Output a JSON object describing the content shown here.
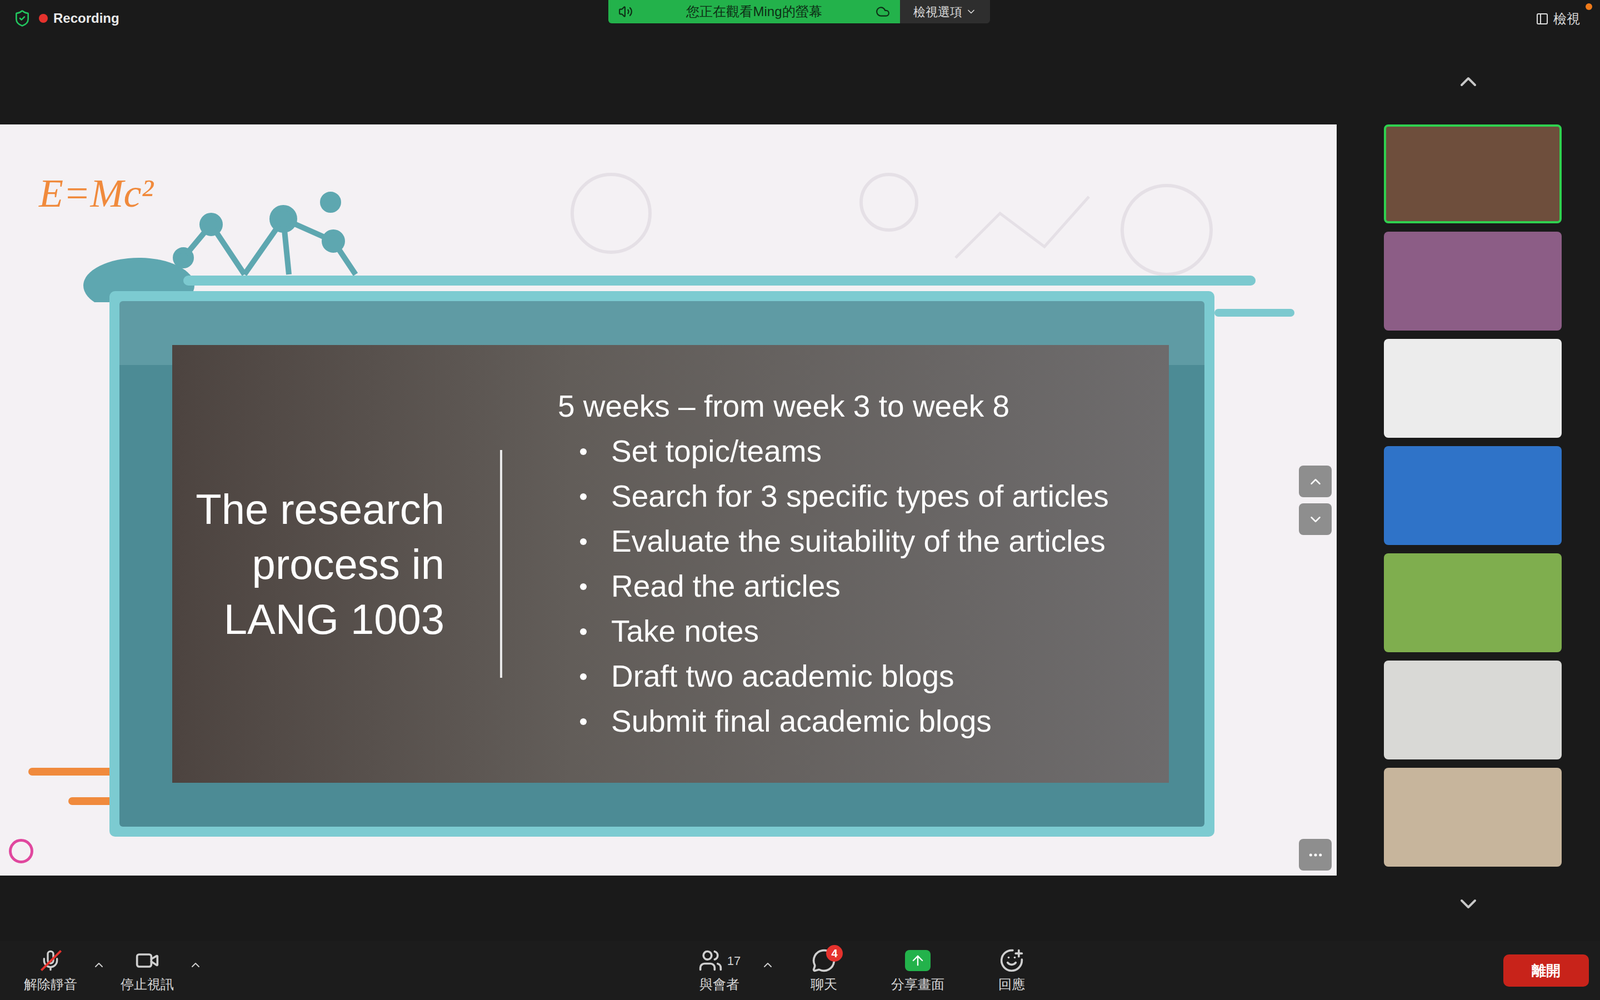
{
  "recording": {
    "label": "Recording"
  },
  "banner": {
    "text": "您正在觀看Ming的螢幕",
    "options": "檢視選項"
  },
  "view_button": {
    "label": "檢視",
    "notification": true
  },
  "slide": {
    "formula": "E=Mc²",
    "title_lines": [
      "The research",
      "process in",
      "LANG 1003"
    ],
    "heading": "5 weeks – from week 3 to week 8",
    "bullets": [
      "Set topic/teams",
      "Search for 3 specific types of articles",
      "Evaluate the suitability of the articles",
      "Read the articles",
      "Take notes",
      "Draft two academic blogs",
      "Submit final academic blogs"
    ]
  },
  "participants": [
    {
      "active": true,
      "color": "#6e4e3c"
    },
    {
      "active": false,
      "color": "#8c5d86"
    },
    {
      "active": false,
      "color": "#ececec"
    },
    {
      "active": false,
      "color": "#2f73c8"
    },
    {
      "active": false,
      "color": "#7fae4e"
    },
    {
      "active": false,
      "color": "#d9d9d6"
    },
    {
      "active": false,
      "color": "#c7b59c"
    }
  ],
  "toolbar": {
    "mute": {
      "label": "解除靜音",
      "muted": true
    },
    "video": {
      "label": "停止視訊"
    },
    "participants": {
      "label": "與會者",
      "count": "17"
    },
    "chat": {
      "label": "聊天",
      "badge": "4"
    },
    "share": {
      "label": "分享畫面"
    },
    "reactions": {
      "label": "回應"
    },
    "leave": "離開"
  }
}
